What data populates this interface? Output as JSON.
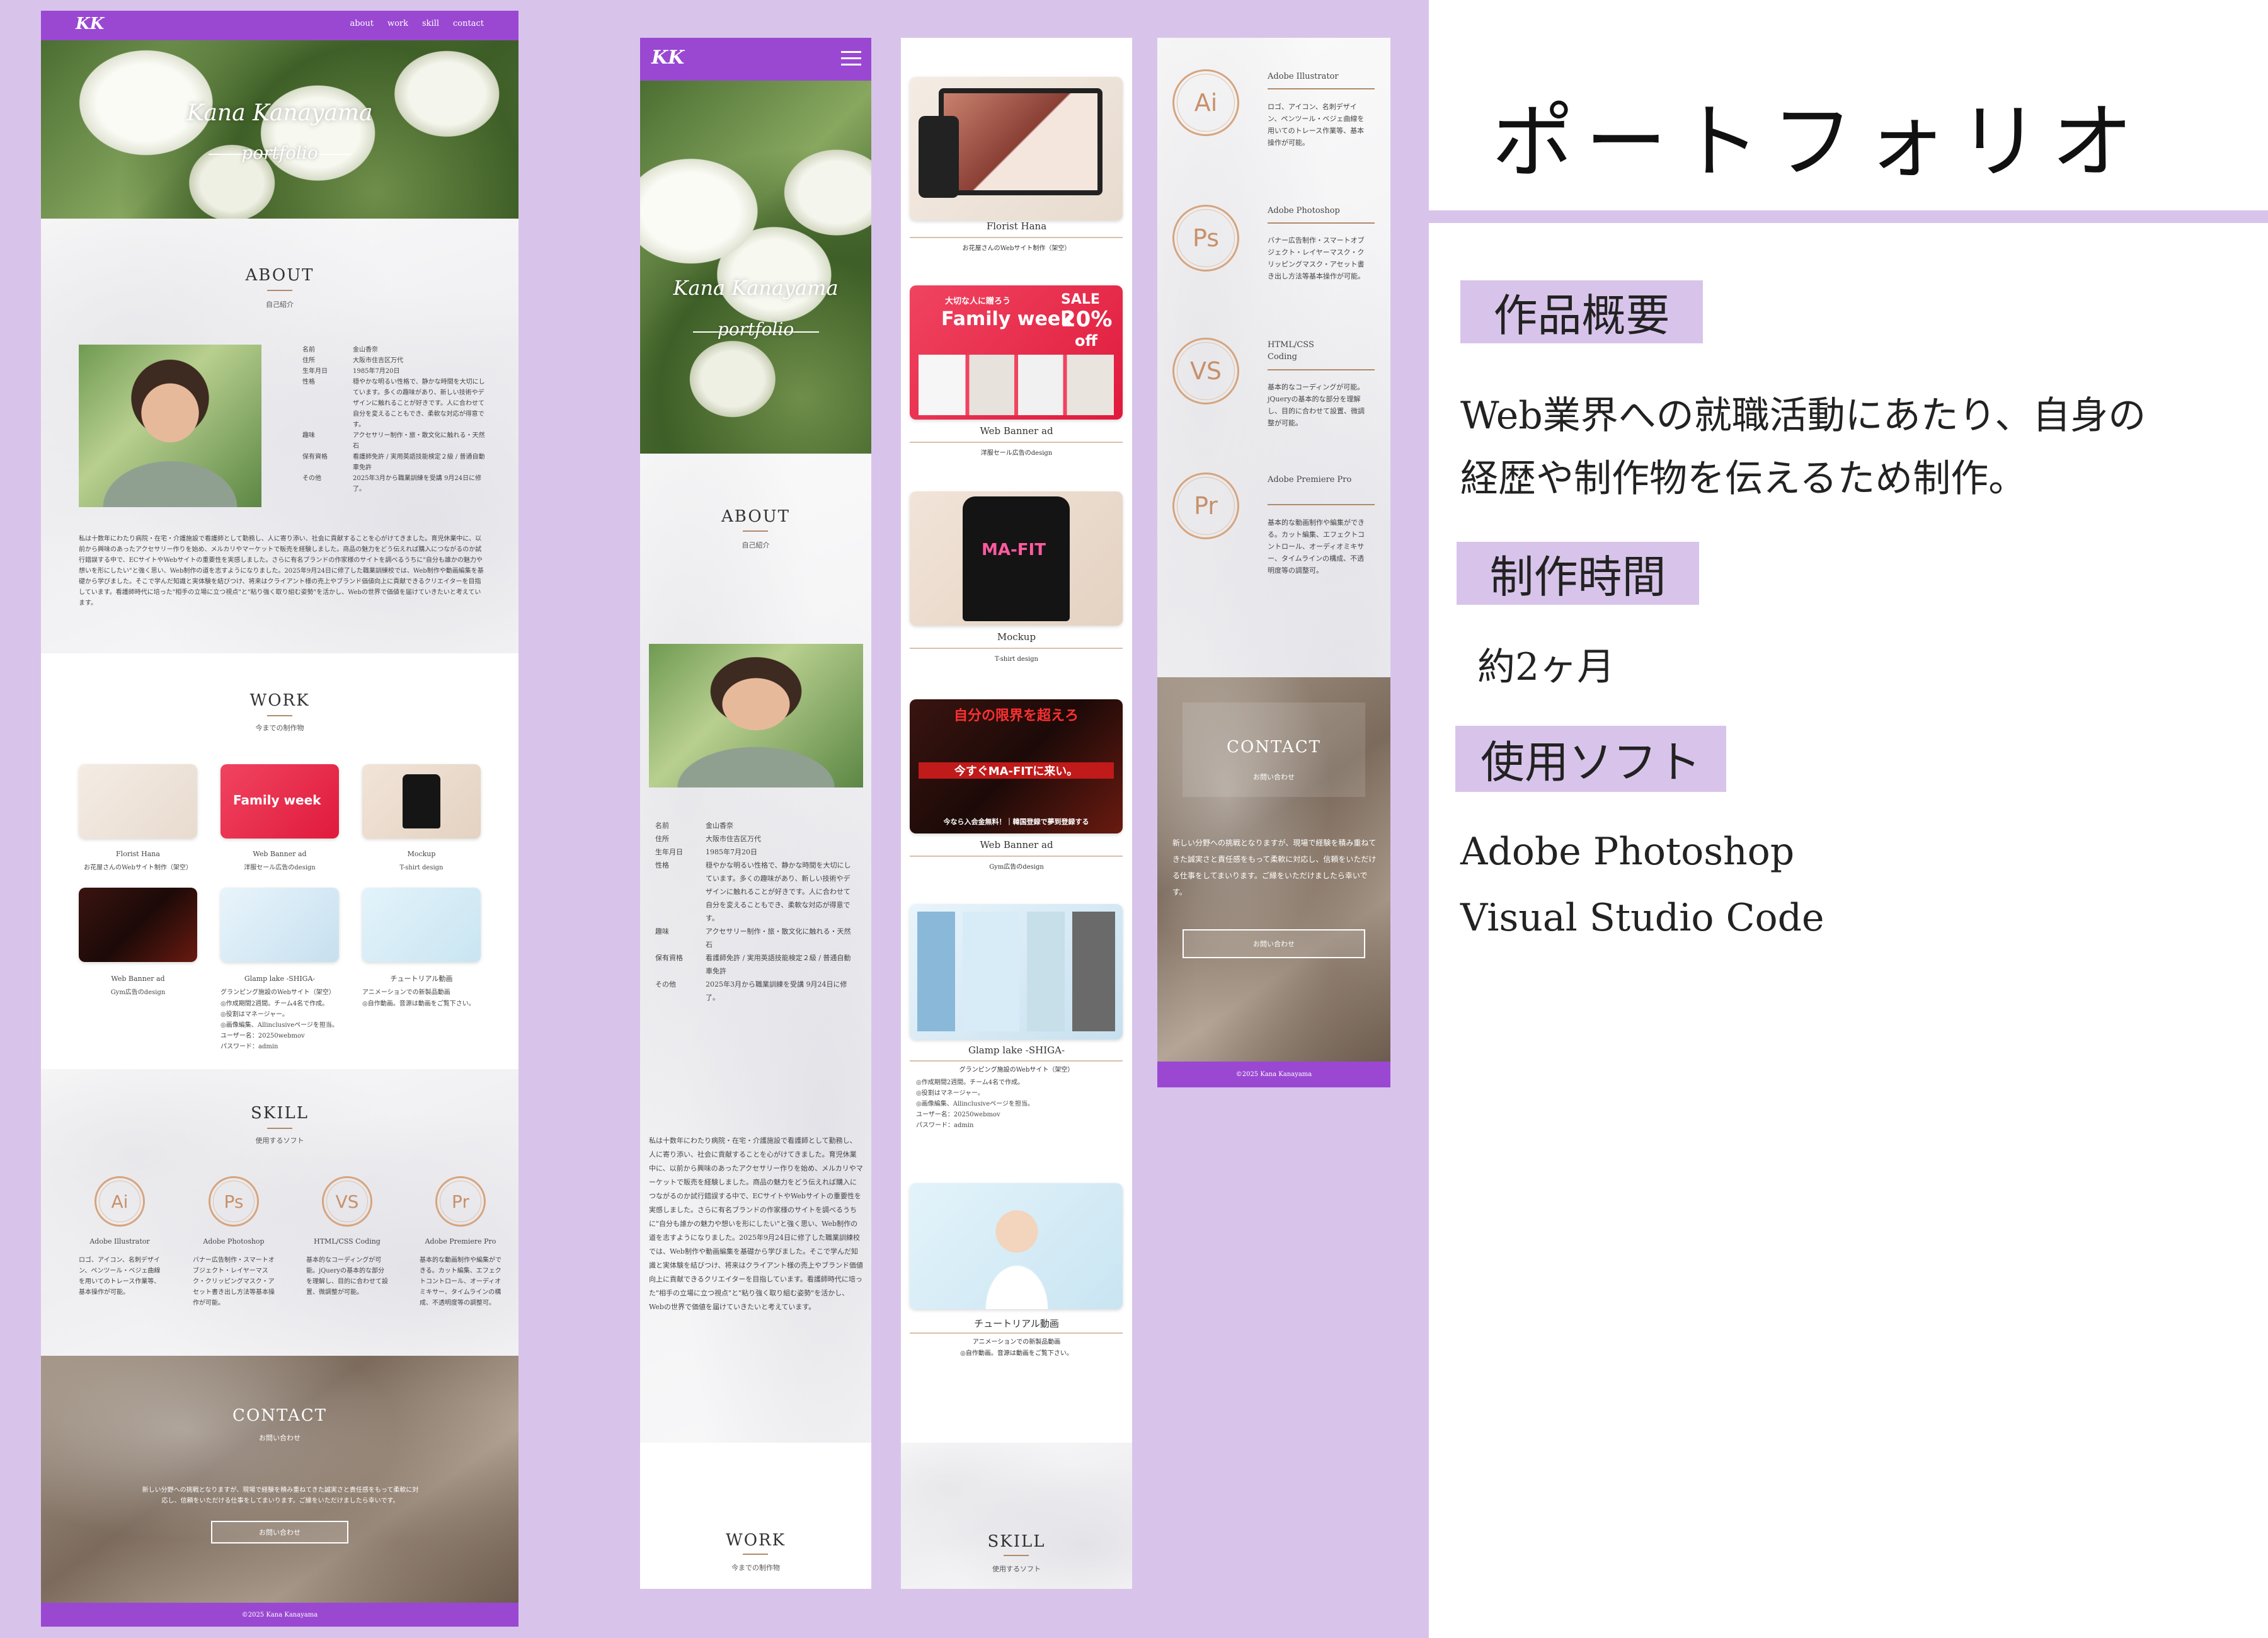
{
  "site": {
    "logo": "KK",
    "nav": [
      "about",
      "work",
      "skill",
      "contact"
    ],
    "hero_title": "Kana Kanayama",
    "hero_subtitle": "portfolio",
    "footer": "©2025 Kana Kanayama"
  },
  "about": {
    "title": "ABOUT",
    "subtitle": "自己紹介",
    "profile": [
      {
        "k": "名前",
        "v": "金山香奈"
      },
      {
        "k": "住所",
        "v": "大阪市住吉区万代"
      },
      {
        "k": "生年月日",
        "v": "1985年7月20日"
      },
      {
        "k": "性格",
        "v": "穏やかな明るい性格で、静かな時間を大切にしています。多くの趣味があり、新しい技術やデザインに触れることが好きです。人に合わせて自分を変えることもでき、柔軟な対応が得意です。"
      },
      {
        "k": "趣味",
        "v": "アクセサリー制作・旅・散文化に触れる・天然石"
      },
      {
        "k": "保有資格",
        "v": "看護師免許 / 実用英語技能検定２級 / 普通自動車免許"
      },
      {
        "k": "その他",
        "v": "2025年3月から職業訓練を受講 9月24日に修了。"
      }
    ],
    "bio": "私は十数年にわたり病院・在宅・介護施設で看護師として勤務し、人に寄り添い、社会に貢献することを心がけてきました。育児休業中に、以前から興味のあったアクセサリー作りを始め、メルカリやマーケットで販売を経験しました。商品の魅力をどう伝えれば購入につながるのか試行錯誤する中で、ECサイトやWebサイトの重要性を実感しました。さらに有名ブランドの作家様のサイトを調べるうちに\"自分も誰かの魅力や想いを形にしたい\"と強く思い、Web制作の道を志すようになりました。2025年9月24日に修了した職業訓練校では、Web制作や動画編集を基礎から学びました。そこで学んだ知識と実体験を結びつけ、将来はクライアント様の売上やブランド価値向上に貢献できるクリエイターを目指しています。看護師時代に培った\"相手の立場に立つ視点\"と\"粘り強く取り組む姿勢\"を活かし、Webの世界で価値を届けていきたいと考えています。"
  },
  "work": {
    "title": "WORK",
    "subtitle": "今までの制作物",
    "items": [
      {
        "name": "Florist Hana",
        "desc": "お花屋さんのWebサイト制作（架空）"
      },
      {
        "name": "Web Banner ad",
        "desc": "洋服セール広告のdesign",
        "banner_top": "大切な人に贈ろう",
        "banner_main": "Family week",
        "banner_sale": "SALE",
        "banner_pct": "20%",
        "banner_off": "off"
      },
      {
        "name": "Mockup",
        "desc": "T-shirt design",
        "shirt_text": "MA-FIT"
      },
      {
        "name": "Web Banner ad",
        "desc": "Gym広告のdesign",
        "gym_line1": "自分の限界を超えろ",
        "gym_line2": "今すぐMA-FITに来い。",
        "gym_line3": "今なら入会金無料！｜韓国登録で夢到登録する"
      },
      {
        "name": "Glamp lake -SHIGA-",
        "desc": "グランピング施設のWebサイト（架空）",
        "details": [
          "◎作成期間2週間。チーム4名で作成。",
          "◎役割はマネージャー。",
          "◎画像編集、Allinclusiveページを担当。",
          "ユーザー名：20250webmov",
          "パスワード：admin"
        ]
      },
      {
        "name": "チュートリアル動画",
        "desc": "アニメーションでの新製品動画",
        "details": [
          "◎自作動画。音源は動画をご覧下さい。"
        ]
      }
    ]
  },
  "skill": {
    "title": "SKILL",
    "subtitle": "使用するソフト",
    "items": [
      {
        "icon": "Ai",
        "name": "Adobe Illustrator",
        "desc": "ロゴ、アイコン、名刺デザイン、ペンツール・ベジェ曲線を用いてのトレース作業等、基本操作が可能。"
      },
      {
        "icon": "Ps",
        "name": "Adobe Photoshop",
        "desc": "バナー広告制作・スマートオブジェクト・レイヤーマスク・クリッピングマスク・アセット書き出し方法等基本操作が可能。"
      },
      {
        "icon": "VS",
        "name": "HTML/CSS Coding",
        "desc": "基本的なコーディングが可能。jQueryの基本的な部分を理解し、目的に合わせて設置、微調整が可能。"
      },
      {
        "icon": "Pr",
        "name": "Adobe Premiere Pro",
        "desc": "基本的な動画制作や編集ができる。カット編集、エフェクトコントロール、オーディオミキサー、タイムラインの構成、不透明度等の調整可。"
      }
    ]
  },
  "contact": {
    "title": "CONTACT",
    "subtitle": "お問い合わせ",
    "body": "新しい分野への挑戦となりますが、現場で経験を積み重ねてきた誠実さと責任感をもって柔軟に対応し、信頼をいただける仕事をしてまいります。ご縁をいただけましたら幸いです。",
    "button": "お問い合わせ"
  },
  "panel": {
    "title": "ポートフォリオ",
    "sections": [
      {
        "label": "作品概要",
        "text": [
          "Web業界への就職活動にあたり、自身の",
          "経歴や制作物を伝えるため制作。"
        ]
      },
      {
        "label": "制作時間",
        "text": [
          "約2ヶ月"
        ]
      },
      {
        "label": "使用ソフト",
        "text": [
          "Adobe Photoshop",
          "Visual Studio Code"
        ]
      }
    ]
  },
  "colors": {
    "accent": "#9a48d2",
    "background": "#d8c4ea",
    "skill_ring": "#d6a47d"
  }
}
